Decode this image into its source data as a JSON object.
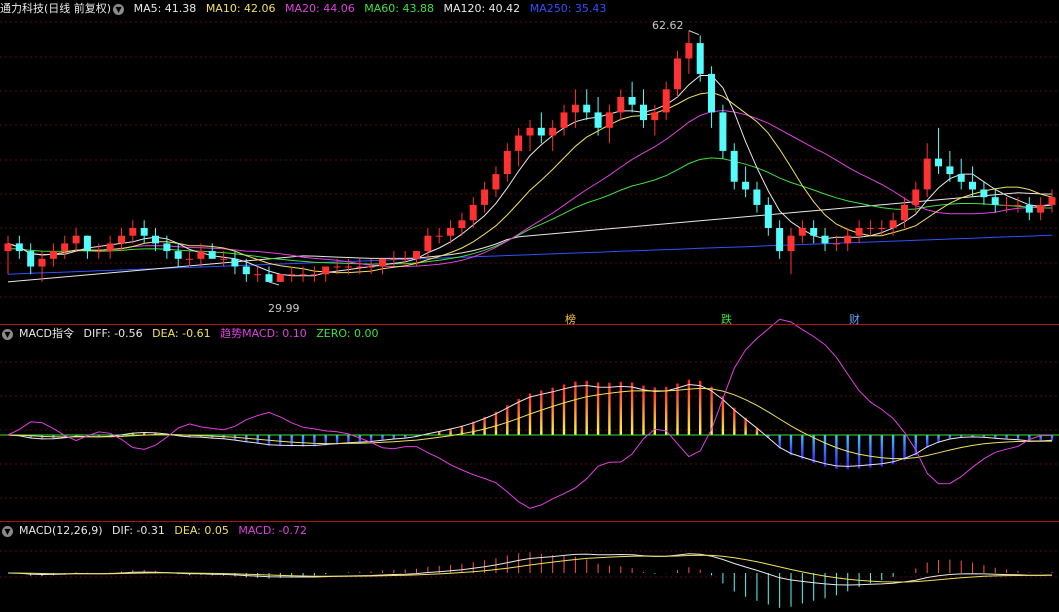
{
  "header": {
    "title": "通力科技(日线 前复权)",
    "ma": [
      {
        "label": "MA5: 41.38",
        "color": "#e8e8e8"
      },
      {
        "label": "MA10: 42.06",
        "color": "#f0e060"
      },
      {
        "label": "MA20: 44.06",
        "color": "#e040e0"
      },
      {
        "label": "MA60: 43.88",
        "color": "#40e040"
      },
      {
        "label": "MA120: 40.42",
        "color": "#e8e8e8"
      },
      {
        "label": "MA250: 35.43",
        "color": "#3050ff"
      }
    ]
  },
  "indicator1": {
    "name": "MACD指令",
    "diff": "DIFF: -0.56",
    "dea": "DEA: -0.61",
    "trend": "趋势",
    "macd": "MACD: 0.10",
    "zero": "ZERO: 0.00"
  },
  "indicator2": {
    "name": "MACD(12,26,9)",
    "dif": "DIF: -0.31",
    "dea": "DEA: 0.05",
    "macd": "MACD: -0.72"
  },
  "annotations": {
    "high": "62.62",
    "low": "29.99",
    "tag1": "榜",
    "tag2": "跌",
    "tag3": "财"
  },
  "colors": {
    "up": "#ff3232",
    "down": "#54fcfc",
    "ma5": "#e8e8e8",
    "ma10": "#f0e060",
    "ma20": "#e040e0",
    "ma60": "#40e040",
    "ma120": "#e8e8e8",
    "ma250": "#3050ff",
    "separator": "#b01010"
  },
  "chart_data": [
    {
      "type": "candlestick",
      "candles": [
        [
          34,
          36,
          31,
          35
        ],
        [
          35,
          36,
          33,
          34
        ],
        [
          34,
          35,
          31,
          32
        ],
        [
          32,
          34,
          30,
          33
        ],
        [
          33,
          35,
          32,
          34
        ],
        [
          34,
          36,
          33,
          35
        ],
        [
          35,
          37,
          34,
          36
        ],
        [
          36,
          36,
          33,
          34
        ],
        [
          34,
          35,
          33,
          34
        ],
        [
          34,
          36,
          33,
          35
        ],
        [
          35,
          37,
          34,
          36
        ],
        [
          36,
          38,
          35,
          37
        ],
        [
          37,
          38,
          35,
          36
        ],
        [
          36,
          37,
          34,
          35
        ],
        [
          35,
          36,
          33,
          34
        ],
        [
          34,
          35,
          32,
          33
        ],
        [
          33,
          34,
          32,
          33
        ],
        [
          33,
          35,
          32,
          34
        ],
        [
          34,
          35,
          33,
          33
        ],
        [
          33,
          34,
          32,
          33
        ],
        [
          33,
          34,
          31,
          32
        ],
        [
          32,
          33,
          30,
          31
        ],
        [
          31,
          32,
          30,
          31
        ],
        [
          31,
          32,
          29.99,
          30
        ],
        [
          30,
          31,
          29.99,
          31
        ],
        [
          31,
          32,
          30,
          31
        ],
        [
          31,
          32,
          30,
          31
        ],
        [
          31,
          32,
          30,
          31
        ],
        [
          31,
          32,
          30,
          32
        ],
        [
          32,
          33,
          31,
          32
        ],
        [
          32,
          33,
          31,
          32
        ],
        [
          32,
          33,
          31,
          32
        ],
        [
          32,
          33,
          31,
          32
        ],
        [
          32,
          33,
          31,
          33
        ],
        [
          33,
          34,
          32,
          33
        ],
        [
          33,
          34,
          32,
          33
        ],
        [
          33,
          34,
          32,
          34
        ],
        [
          34,
          37,
          33,
          36
        ],
        [
          36,
          37,
          35,
          36
        ],
        [
          36,
          38,
          35,
          37
        ],
        [
          37,
          39,
          36,
          38
        ],
        [
          38,
          41,
          37,
          40
        ],
        [
          40,
          43,
          39,
          42
        ],
        [
          42,
          45,
          41,
          44
        ],
        [
          44,
          48,
          43,
          47
        ],
        [
          47,
          50,
          45,
          49
        ],
        [
          49,
          51,
          47,
          50
        ],
        [
          50,
          52,
          48,
          49
        ],
        [
          49,
          51,
          47,
          50
        ],
        [
          50,
          53,
          49,
          52
        ],
        [
          52,
          55,
          50,
          53
        ],
        [
          53,
          55,
          51,
          52
        ],
        [
          52,
          54,
          49,
          50
        ],
        [
          50,
          53,
          48,
          52
        ],
        [
          52,
          55,
          51,
          54
        ],
        [
          54,
          56,
          52,
          53
        ],
        [
          53,
          55,
          50,
          51
        ],
        [
          51,
          53,
          49,
          52
        ],
        [
          52,
          56,
          51,
          55
        ],
        [
          55,
          60,
          54,
          59
        ],
        [
          59,
          62.62,
          57,
          61
        ],
        [
          61,
          62,
          56,
          57
        ],
        [
          57,
          58,
          50,
          52
        ],
        [
          52,
          53,
          46,
          47
        ],
        [
          47,
          48,
          42,
          43
        ],
        [
          43,
          45,
          41,
          42
        ],
        [
          42,
          43,
          39,
          40
        ],
        [
          40,
          41,
          36,
          37
        ],
        [
          37,
          38,
          33,
          34
        ],
        [
          34,
          37,
          31,
          36
        ],
        [
          36,
          38,
          35,
          37
        ],
        [
          37,
          38,
          35,
          36
        ],
        [
          36,
          37,
          34,
          35
        ],
        [
          35,
          36,
          34,
          35
        ],
        [
          35,
          37,
          34,
          36
        ],
        [
          36,
          38,
          35,
          37
        ],
        [
          37,
          38,
          36,
          37
        ],
        [
          37,
          38,
          36,
          37
        ],
        [
          37,
          39,
          36,
          38
        ],
        [
          38,
          41,
          37,
          40
        ],
        [
          40,
          43,
          39,
          42
        ],
        [
          42,
          48,
          41,
          46
        ],
        [
          46,
          50,
          44,
          45
        ],
        [
          45,
          47,
          43,
          44
        ],
        [
          44,
          46,
          42,
          43
        ],
        [
          43,
          45,
          41,
          42
        ],
        [
          42,
          43,
          40,
          41
        ],
        [
          41,
          42,
          39,
          40
        ],
        [
          40,
          41,
          39,
          40
        ],
        [
          40,
          41,
          39,
          40
        ],
        [
          40,
          41,
          38,
          39
        ],
        [
          39,
          41,
          38,
          40
        ],
        [
          40,
          42,
          39,
          41
        ]
      ],
      "highest": 62.62,
      "lowest": 29.99
    },
    {
      "type": "bar",
      "name": "MACD指令",
      "diff": -0.56,
      "dea": -0.61,
      "macd": 0.1
    },
    {
      "type": "bar",
      "name": "MACD(12,26,9)",
      "dif": -0.31,
      "dea": 0.05,
      "macd": -0.72
    }
  ]
}
